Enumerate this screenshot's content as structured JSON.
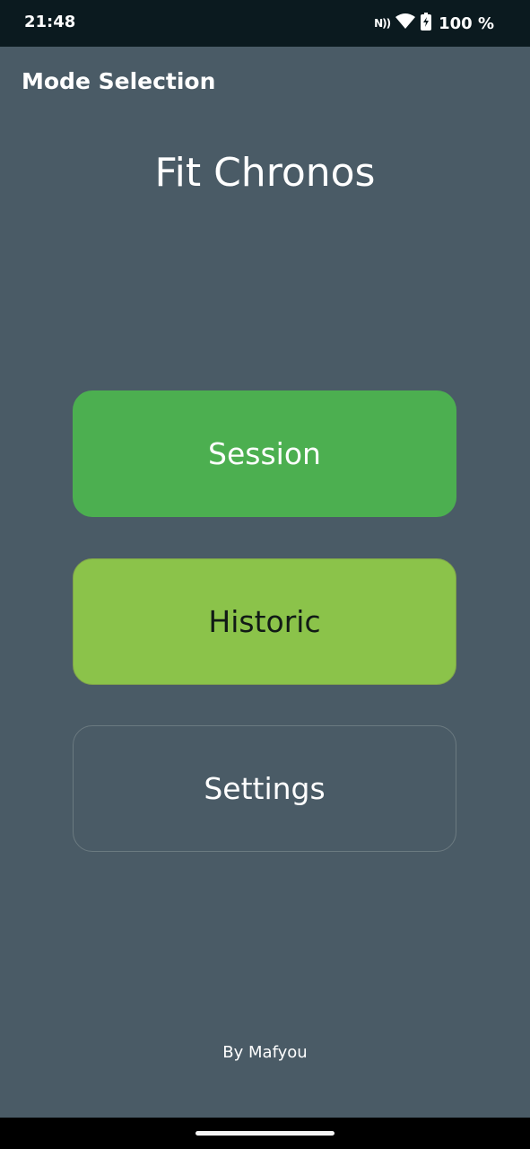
{
  "status_bar": {
    "time": "21:48",
    "nfc_label": "N))",
    "battery_percent": "100 %",
    "icons": [
      "nfc-icon",
      "wifi-icon",
      "battery-icon"
    ]
  },
  "app_bar": {
    "title": "Mode Selection"
  },
  "main": {
    "app_name": "Fit Chronos",
    "buttons": [
      {
        "label": "Session",
        "color": "#4caf50"
      },
      {
        "label": "Historic",
        "color": "#8bc34a"
      },
      {
        "label": "Settings",
        "color": "transparent"
      }
    ],
    "credit": "By Mafyou"
  },
  "colors": {
    "background": "#4a5b66",
    "status_bar": "#0b1a1f",
    "nav_bar": "#000000"
  }
}
